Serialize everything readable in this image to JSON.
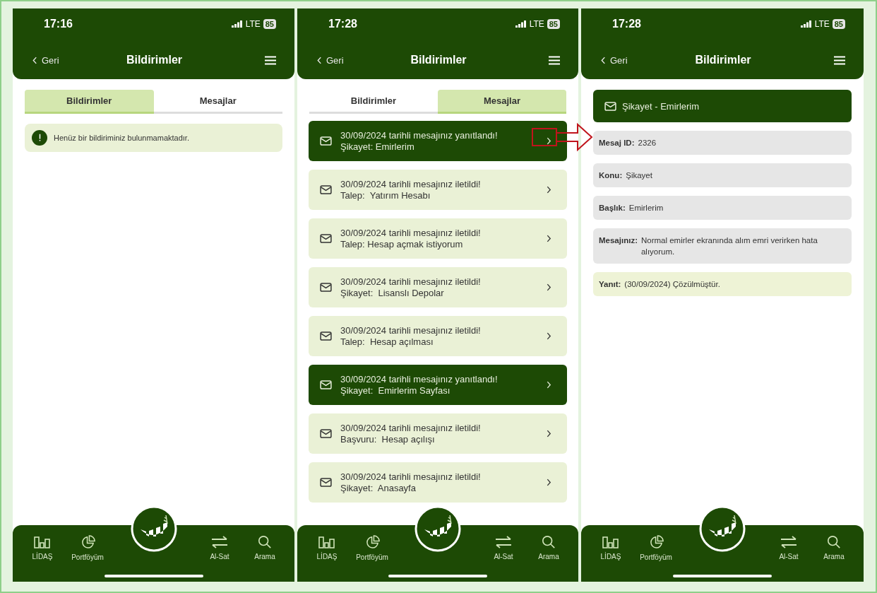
{
  "phones": [
    {
      "kind": "notifications",
      "status": {
        "time": "17:16",
        "network": "LTE",
        "battery": "85"
      },
      "header": {
        "back": "Geri",
        "title": "Bildirimler"
      },
      "tabs": [
        {
          "label": "Bildirimler",
          "selected": true
        },
        {
          "label": "Mesajlar",
          "selected": false
        }
      ],
      "notice": "Henüz bir bildiriminiz bulunmamaktadır.",
      "nav": [
        "LİDAŞ",
        "Portföyüm",
        "Al-Sat",
        "Arama"
      ]
    },
    {
      "kind": "messages",
      "status": {
        "time": "17:28",
        "network": "LTE",
        "battery": "85"
      },
      "header": {
        "back": "Geri",
        "title": "Bildirimler"
      },
      "tabs": [
        {
          "label": "Bildirimler",
          "selected": false
        },
        {
          "label": "Mesajlar",
          "selected": true
        }
      ],
      "messages": [
        {
          "title": "30/09/2024 tarihli mesajınız yanıtlandı!",
          "subject": "Şikayet: Emirlerim",
          "answered": true
        },
        {
          "title": "30/09/2024 tarihli mesajınız iletildi!",
          "subject": "Talep:  Yatırım Hesabı",
          "answered": false
        },
        {
          "title": "30/09/2024 tarihli mesajınız iletildi!",
          "subject": "Talep: Hesap açmak istiyorum",
          "answered": false
        },
        {
          "title": "30/09/2024 tarihli mesajınız iletildi!",
          "subject": "Şikayet:  Lisanslı Depolar",
          "answered": false
        },
        {
          "title": "30/09/2024 tarihli mesajınız iletildi!",
          "subject": "Talep:  Hesap açılması",
          "answered": false
        },
        {
          "title": "30/09/2024 tarihli mesajınız yanıtlandı!",
          "subject": "Şikayet:  Emirlerim Sayfası",
          "answered": true
        },
        {
          "title": "30/09/2024 tarihli mesajınız iletildi!",
          "subject": "Başvuru:  Hesap açılışı",
          "answered": false
        },
        {
          "title": "30/09/2024 tarihli mesajınız iletildi!",
          "subject": "Şikayet:  Anasayfa",
          "answered": false
        }
      ],
      "nav": [
        "LİDAŞ",
        "Portföyüm",
        "Al-Sat",
        "Arama"
      ]
    },
    {
      "kind": "detail",
      "status": {
        "time": "17:28",
        "network": "LTE",
        "battery": "85"
      },
      "header": {
        "back": "Geri",
        "title": "Bildirimler"
      },
      "detail_title": "Şikayet - Emirlerim",
      "fields": [
        {
          "kind": "info",
          "label": "Mesaj ID:",
          "value": "2326"
        },
        {
          "kind": "info",
          "label": "Konu:",
          "value": "Şikayet"
        },
        {
          "kind": "info",
          "label": "Başlık:",
          "value": "Emirlerim"
        },
        {
          "kind": "info",
          "label": "Mesajınız:",
          "value": "Normal emirler ekranında alım emri verirken hata alıyorum."
        },
        {
          "kind": "reply",
          "label": "Yanıt:",
          "value": "(30/09/2024) Çözülmüştür."
        }
      ],
      "nav": [
        "LİDAŞ",
        "Portföyüm",
        "Al-Sat",
        "Arama"
      ]
    }
  ]
}
